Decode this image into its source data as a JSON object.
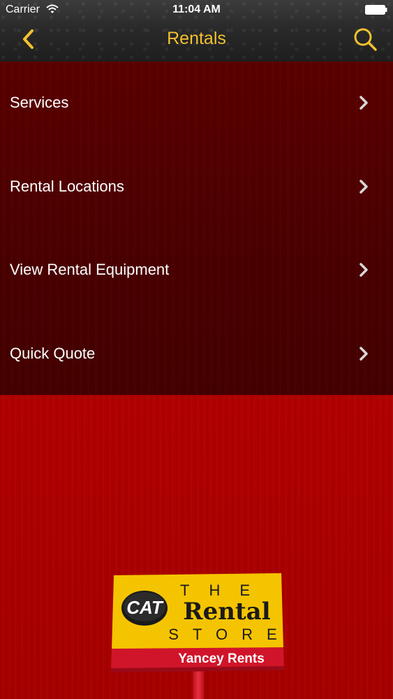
{
  "status_bar": {
    "carrier": "Carrier",
    "time": "11:04 AM",
    "wifi_icon": "wifi-icon",
    "battery_icon": "battery-icon"
  },
  "nav": {
    "title": "Rentals",
    "back_icon": "chevron-left-icon",
    "search_icon": "search-icon",
    "accent_color": "#f2c12e"
  },
  "menu": {
    "items": [
      {
        "label": "Services"
      },
      {
        "label": "Rental Locations"
      },
      {
        "label": "View Rental Equipment"
      },
      {
        "label": "Quick Quote"
      }
    ],
    "chevron_icon": "chevron-right-icon"
  },
  "sign": {
    "logo_lettering": "CAT",
    "the": "THE",
    "rental": "Rental",
    "store": "STORE",
    "dealer": "Yancey Rents"
  },
  "colors": {
    "menu_background": "#4a0000",
    "page_background": "#a80000",
    "sign_yellow": "#f5c400",
    "sign_red": "#d0152a"
  }
}
